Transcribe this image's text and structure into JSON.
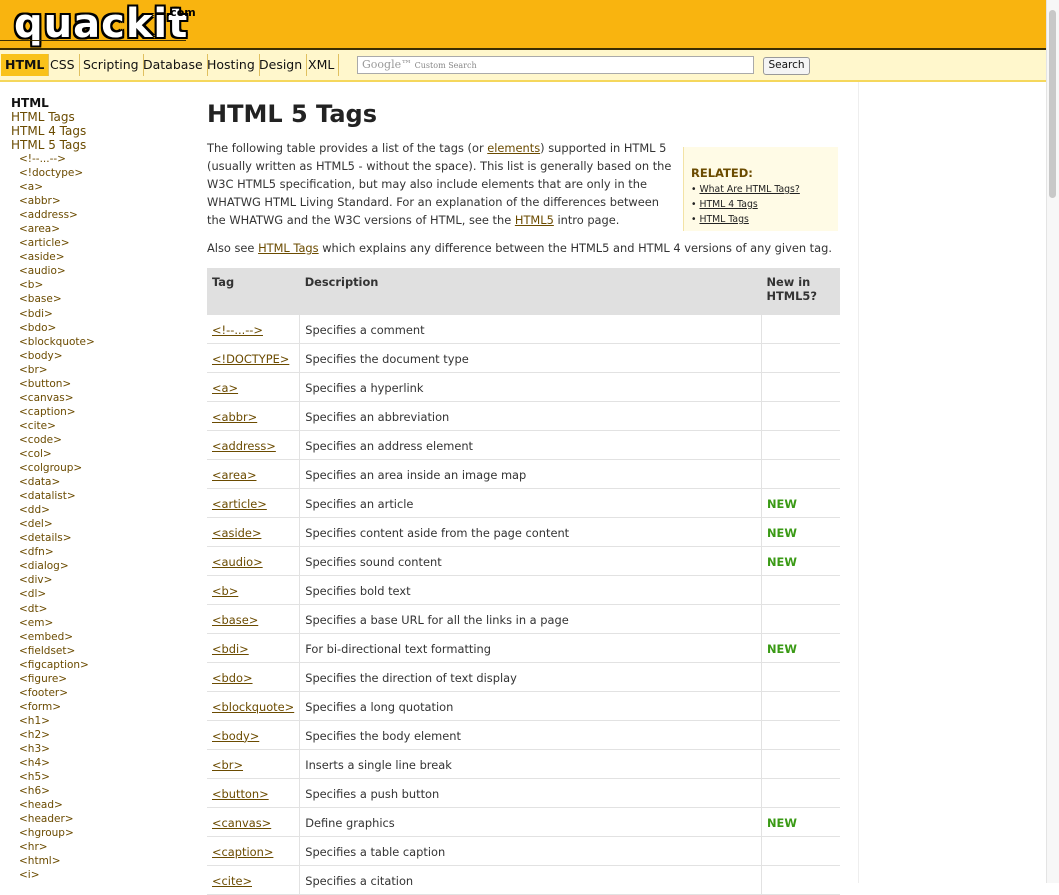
{
  "site": {
    "logo": "quackit",
    "logo_suffix": ".com"
  },
  "nav": {
    "items": [
      {
        "label": "HTML",
        "active": true
      },
      {
        "label": "CSS"
      },
      {
        "label": "Scripting"
      },
      {
        "label": "Database"
      },
      {
        "label": "Hosting"
      },
      {
        "label": "Design"
      },
      {
        "label": "XML"
      }
    ],
    "search_brand": "Google™",
    "search_placeholder": "Custom Search",
    "search_button": "Search"
  },
  "sidebar": {
    "heading": "HTML",
    "links": [
      "HTML Tags",
      "HTML 4 Tags",
      "HTML 5 Tags"
    ],
    "tags": [
      "<!--...-->",
      "<!doctype>",
      "<a>",
      "<abbr>",
      "<address>",
      "<area>",
      "<article>",
      "<aside>",
      "<audio>",
      "<b>",
      "<base>",
      "<bdi>",
      "<bdo>",
      "<blockquote>",
      "<body>",
      "<br>",
      "<button>",
      "<canvas>",
      "<caption>",
      "<cite>",
      "<code>",
      "<col>",
      "<colgroup>",
      "<data>",
      "<datalist>",
      "<dd>",
      "<del>",
      "<details>",
      "<dfn>",
      "<dialog>",
      "<div>",
      "<dl>",
      "<dt>",
      "<em>",
      "<embed>",
      "<fieldset>",
      "<figcaption>",
      "<figure>",
      "<footer>",
      "<form>",
      "<h1>",
      "<h2>",
      "<h3>",
      "<h4>",
      "<h5>",
      "<h6>",
      "<head>",
      "<header>",
      "<hgroup>",
      "<hr>",
      "<html>",
      "<i>"
    ]
  },
  "main": {
    "title": "HTML 5 Tags",
    "intro": {
      "p1": "The following table provides a list of the tags (or ",
      "link1": "elements",
      "p2": ") supported in HTML 5 (usually written as HTML5 - without the space). This list is generally based on the W3C HTML5 specification, but may also include elements that are only in the WHATWG HTML Living Standard. For an explanation of the differences between the WHATWG and the W3C versions of HTML, see the ",
      "link2": "HTML5",
      "p3": " intro page."
    },
    "also": {
      "p1": "Also see ",
      "link": "HTML Tags",
      "p2": " which explains any difference between the HTML5 and HTML 4 versions of any given tag."
    },
    "related": {
      "title": "RELATED:",
      "items": [
        "What Are HTML Tags?",
        "HTML 4 Tags",
        "HTML Tags"
      ]
    },
    "table": {
      "headers": [
        "Tag",
        "Description",
        "New in HTML5?"
      ],
      "rows": [
        {
          "tag": "<!--...-->",
          "desc": "Specifies a comment",
          "new": ""
        },
        {
          "tag": "<!DOCTYPE>",
          "desc": "Specifies the document type",
          "new": ""
        },
        {
          "tag": "<a>",
          "desc": "Specifies a hyperlink",
          "new": ""
        },
        {
          "tag": "<abbr>",
          "desc": "Specifies an abbreviation",
          "new": ""
        },
        {
          "tag": "<address>",
          "desc": "Specifies an address element",
          "new": ""
        },
        {
          "tag": "<area>",
          "desc": "Specifies an area inside an image map",
          "new": ""
        },
        {
          "tag": "<article>",
          "desc": "Specifies an article",
          "new": "NEW"
        },
        {
          "tag": "<aside>",
          "desc": "Specifies content aside from the page content",
          "new": "NEW"
        },
        {
          "tag": "<audio>",
          "desc": "Specifies sound content",
          "new": "NEW"
        },
        {
          "tag": "<b>",
          "desc": "Specifies bold text",
          "new": ""
        },
        {
          "tag": "<base>",
          "desc": "Specifies a base URL for all the links in a page",
          "new": ""
        },
        {
          "tag": "<bdi>",
          "desc": "For bi-directional text formatting",
          "new": "NEW"
        },
        {
          "tag": "<bdo>",
          "desc": "Specifies the direction of text display",
          "new": ""
        },
        {
          "tag": "<blockquote>",
          "desc": "Specifies a long quotation",
          "new": ""
        },
        {
          "tag": "<body>",
          "desc": "Specifies the body element",
          "new": ""
        },
        {
          "tag": "<br>",
          "desc": "Inserts a single line break",
          "new": ""
        },
        {
          "tag": "<button>",
          "desc": "Specifies a push button",
          "new": ""
        },
        {
          "tag": "<canvas>",
          "desc": "Define graphics",
          "new": "NEW"
        },
        {
          "tag": "<caption>",
          "desc": "Specifies a table caption",
          "new": ""
        },
        {
          "tag": "<cite>",
          "desc": "Specifies a citation",
          "new": ""
        }
      ]
    }
  },
  "colors": {
    "header_bg": "#f9b40f",
    "nav_bg": "#fff7cc",
    "link": "#6b4b00",
    "new_badge": "#3a9a15"
  }
}
